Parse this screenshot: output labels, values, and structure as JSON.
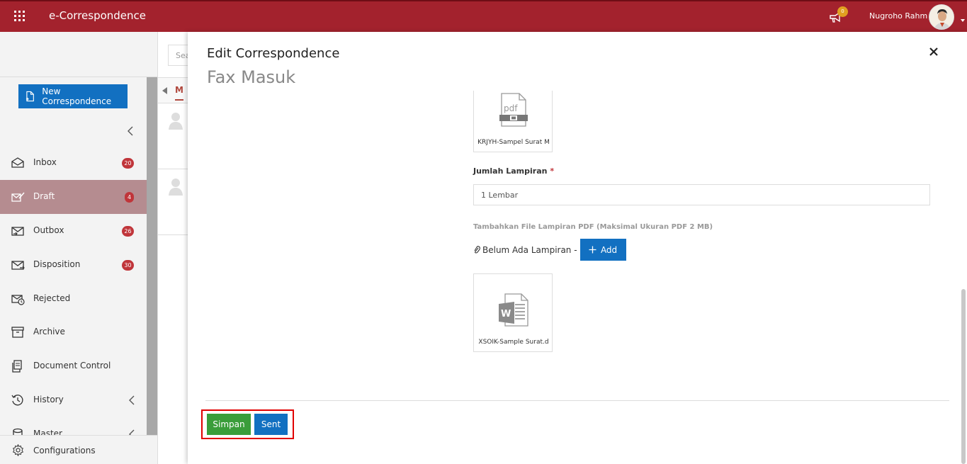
{
  "header": {
    "app_title": "e-Correspondence",
    "notification_count": "0",
    "username": "Nugroho Rahm"
  },
  "sidebar": {
    "new_button_label": "New Correspondence",
    "items": [
      {
        "label": "Inbox",
        "badge": "20",
        "icon": "inbox-icon"
      },
      {
        "label": "Draft",
        "badge": "4",
        "icon": "draft-icon",
        "active": true
      },
      {
        "label": "Outbox",
        "badge": "26",
        "icon": "outbox-icon"
      },
      {
        "label": "Disposition",
        "badge": "30",
        "icon": "disposition-icon"
      },
      {
        "label": "Rejected",
        "icon": "rejected-icon"
      },
      {
        "label": "Archive",
        "icon": "archive-icon"
      },
      {
        "label": "Document Control",
        "icon": "document-control-icon"
      },
      {
        "label": "History",
        "icon": "history-icon"
      },
      {
        "label": "Master",
        "icon": "master-icon"
      }
    ],
    "configurations_label": "Configurations"
  },
  "list": {
    "search_placeholder": "Sea",
    "tab_label": "M"
  },
  "modal": {
    "title": "Edit Correspondence",
    "subtitle": "Fax Masuk",
    "pdf_file_name": "KRJYH-Sampel Surat M",
    "jumlah_label": "Jumlah Lampiran",
    "required_mark": "*",
    "jumlah_value": "1 Lembar",
    "hint": "Tambahkan File Lampiran PDF (Maksimal Ukuran PDF 2 MB)",
    "no_attachment_text": "Belum Ada Lampiran -",
    "add_label": "Add",
    "word_file_name": "XSOIK-Sample Surat.d",
    "simpan_label": "Simpan",
    "sent_label": "Sent"
  },
  "colors": {
    "topbar": "#a3222d",
    "primary": "#1270c1",
    "success": "#3a9d3a",
    "active_nav": "#b58c90",
    "badge": "#c0353a",
    "highlight": "#e10000"
  }
}
